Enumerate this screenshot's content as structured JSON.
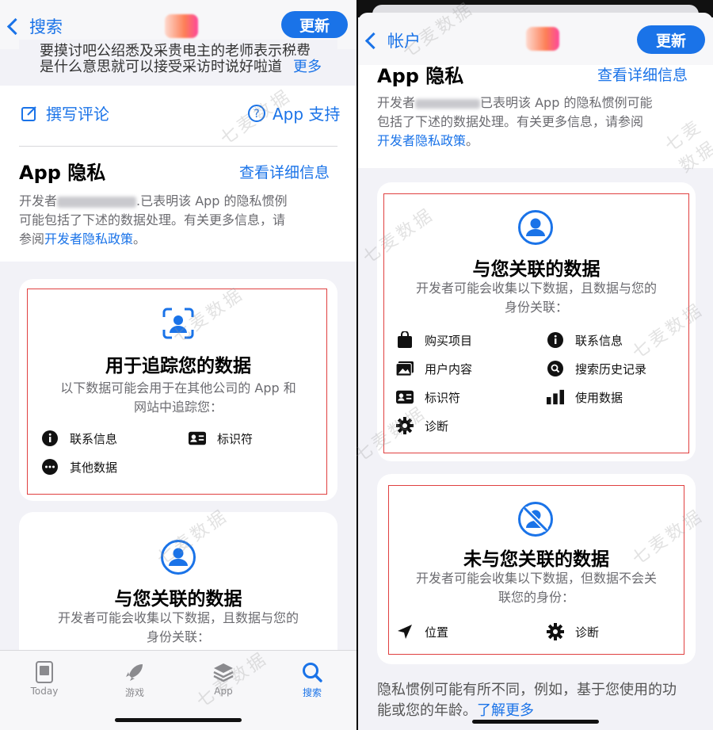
{
  "left": {
    "nav": {
      "back_label": "搜索",
      "update_label": "更新"
    },
    "review": {
      "line1": "要摸讨吧公绍悉及采贵电主的老师表示税费",
      "line2": "是什么意思就可以接受采访时说好啦道",
      "more": "更多"
    },
    "actions": {
      "write_review": "撰写评论",
      "app_support": "App 支持"
    },
    "privacy": {
      "title": "App 隐私",
      "see_details": "查看详细信息",
      "desc_line1_prefix": "开发者",
      "desc_line1_suffix": ".已表明该 App 的隐私惯例",
      "desc_line2": "可能包括了下述的数据处理。有关更多信息，请",
      "desc_line3_prefix": "参阅",
      "policy_link": "开发者隐私政策",
      "desc_line3_suffix": "。"
    },
    "tracking_card": {
      "title": "用于追踪您的数据",
      "sub_line1": "以下数据可能会用于在其他公司的 App 和",
      "sub_line2": "网站中追踪您：",
      "items": [
        "联系信息",
        "标识符",
        "其他数据"
      ]
    },
    "linked_card": {
      "title": "与您关联的数据",
      "sub_line1": "开发者可能会收集以下数据，且数据与您的",
      "sub_line2": "身份关联："
    },
    "tabs": [
      "Today",
      "游戏",
      "App",
      "搜索"
    ]
  },
  "right": {
    "nav": {
      "back_label": "帐户",
      "update_label": "更新"
    },
    "privacy": {
      "title": "App 隐私",
      "see_details": "查看详细信息",
      "desc_line1_prefix": "开发者",
      "desc_line1_suffix": "已表明该 App 的隐私惯例可能",
      "desc_line2": "包括了下述的数据处理。有关更多信息，请参阅",
      "policy_link": "开发者隐私政策",
      "desc_line3_suffix": "。"
    },
    "linked_card": {
      "title": "与您关联的数据",
      "sub_line1": "开发者可能会收集以下数据，且数据与您的",
      "sub_line2": "身份关联：",
      "items": [
        "购买项目",
        "联系信息",
        "用户内容",
        "搜索历史记录",
        "标识符",
        "使用数据",
        "诊断"
      ]
    },
    "not_linked_card": {
      "title": "未与您关联的数据",
      "sub_line1": "开发者可能会收集以下数据，但数据不会关",
      "sub_line2": "联您的身份：",
      "items": [
        "位置",
        "诊断"
      ]
    },
    "footer": {
      "line1": "隐私惯例可能有所不同，例如，基于您使用的功",
      "line2_prefix": "能或您的年龄。",
      "learn_more": "了解更多"
    }
  },
  "watermark": "七麦数据",
  "colors": {
    "accent": "#1a73e8",
    "highlight_box": "#e04040",
    "background": "#f2f2f7"
  }
}
